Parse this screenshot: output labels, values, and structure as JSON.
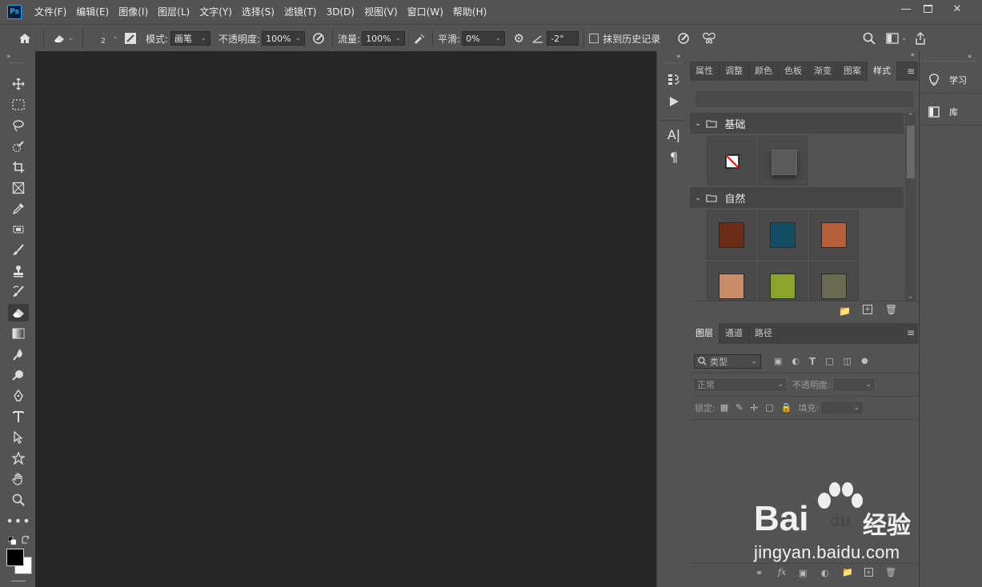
{
  "app": {
    "logo": "Ps"
  },
  "menu": [
    "文件(F)",
    "编辑(E)",
    "图像(I)",
    "图层(L)",
    "文字(Y)",
    "选择(S)",
    "滤镜(T)",
    "3D(D)",
    "视图(V)",
    "窗口(W)",
    "帮助(H)"
  ],
  "options": {
    "brush_size": "2",
    "mode_label": "模式:",
    "mode_value": "画笔",
    "opacity_label": "不透明度:",
    "opacity_value": "100%",
    "flow_label": "流量:",
    "flow_value": "100%",
    "smooth_label": "平滑:",
    "smooth_value": "0%",
    "angle_value": "-2°",
    "erase_history_label": "抹到历史记录"
  },
  "styles_panel": {
    "tabs": [
      "属性",
      "调整",
      "颜色",
      "色板",
      "渐变",
      "图案",
      "样式"
    ],
    "active_tab": "样式",
    "groups": [
      {
        "name": "基础"
      },
      {
        "name": "自然"
      }
    ],
    "swatch_colors": [
      "#6b2b14",
      "#164e66",
      "#b45e3a",
      "#c98c68",
      "#8aa52a",
      "#6a6a50"
    ]
  },
  "layers_panel": {
    "tabs": [
      "图层",
      "通道",
      "路径"
    ],
    "active_tab": "图层",
    "filter_label": "类型",
    "blend_mode": "正常",
    "opacity_label": "不透明度:",
    "lock_label": "锁定:",
    "fill_label": "填充:"
  },
  "right_panel": {
    "items": [
      "学习",
      "库"
    ]
  },
  "watermark": {
    "brand": "Bai",
    "brand_du": "du",
    "brand_cn": "经验",
    "url": "jingyan.baidu.com"
  },
  "colors": {
    "ui_bg": "#535353",
    "canvas_bg": "#262626",
    "accent_ps": "#31a8ff"
  }
}
